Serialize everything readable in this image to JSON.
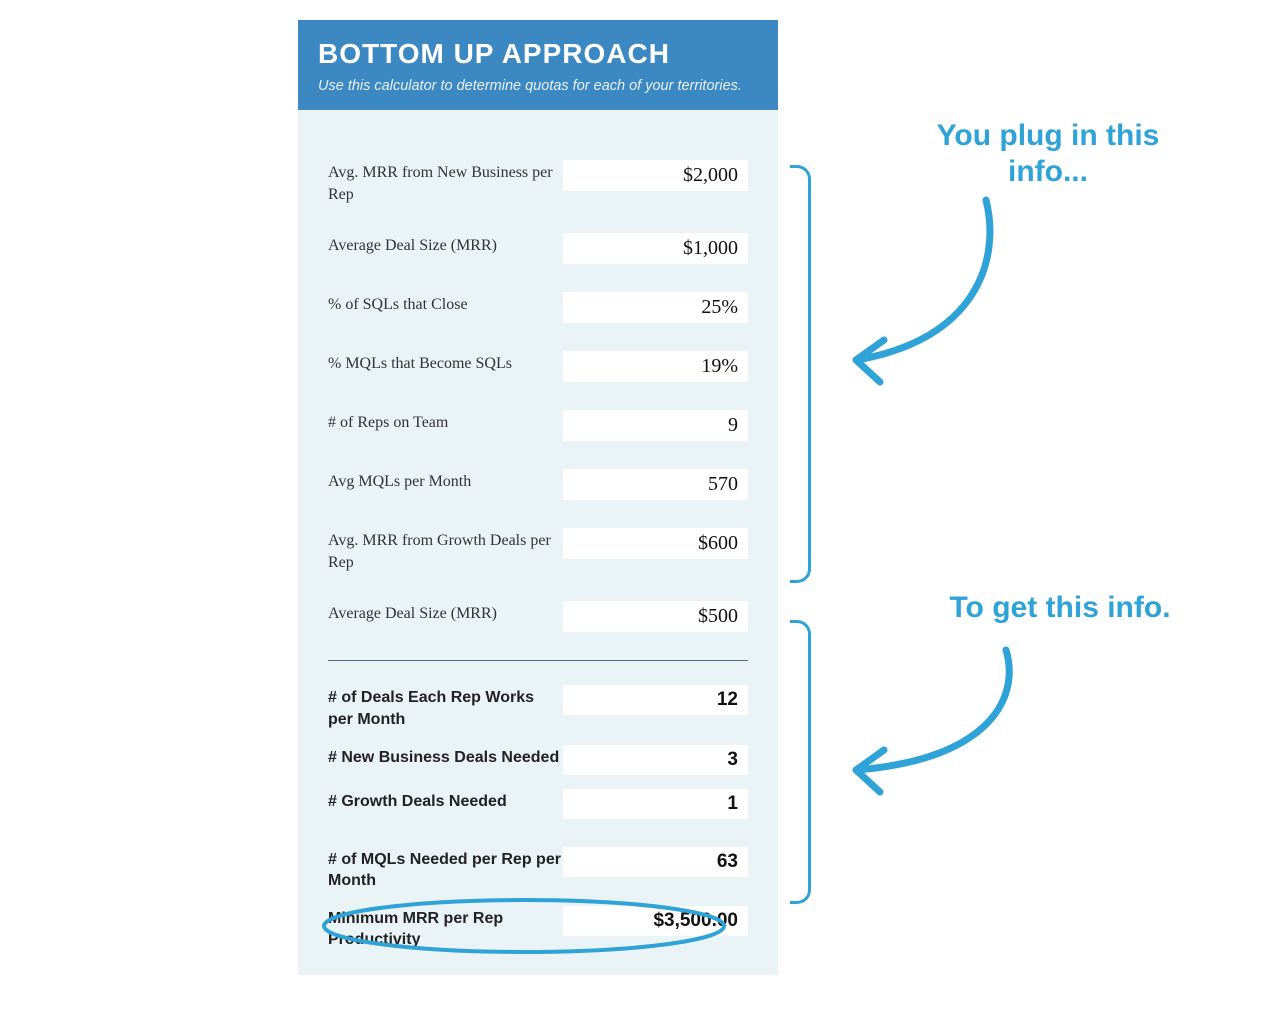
{
  "header": {
    "title": "BOTTOM UP APPROACH",
    "subtitle": "Use this calculator to determine quotas for each of your territories."
  },
  "inputs": {
    "avg_mrr_new_label": "Avg. MRR from New Business per Rep",
    "avg_mrr_new_value": "$2,000",
    "avg_deal_size_label": "Average Deal Size (MRR)",
    "avg_deal_size_value": "$1,000",
    "sql_close_label": "% of SQLs that Close",
    "sql_close_value": "25%",
    "mql_sql_label": "% MQLs that Become SQLs",
    "mql_sql_value": "19%",
    "reps_label": "# of Reps on Team",
    "reps_value": "9",
    "mqls_label": "Avg MQLs per Month",
    "mqls_value": "570",
    "avg_mrr_growth_label": "Avg. MRR from Growth Deals per Rep",
    "avg_mrr_growth_value": "$600",
    "avg_deal_size2_label": "Average Deal Size (MRR)",
    "avg_deal_size2_value": "$500"
  },
  "outputs": {
    "deals_label": "# of Deals Each Rep Works per Month",
    "deals_value": "12",
    "new_biz_label": "# New Business Deals Needed",
    "new_biz_value": "3",
    "growth_label": "# Growth Deals Needed",
    "growth_value": "1",
    "mqls_needed_label": "# of MQLs Needed per Rep per Month",
    "mqls_needed_value": "63",
    "min_mrr_label": "Minimum MRR per Rep Productivity",
    "min_mrr_value": "$3,500.00"
  },
  "annotations": {
    "top": "You plug in this info...",
    "bottom": "To get this info."
  },
  "colors": {
    "accent": "#2fa3d7",
    "header_bg": "#3b88c3",
    "panel_bg": "#eaf3f6"
  }
}
